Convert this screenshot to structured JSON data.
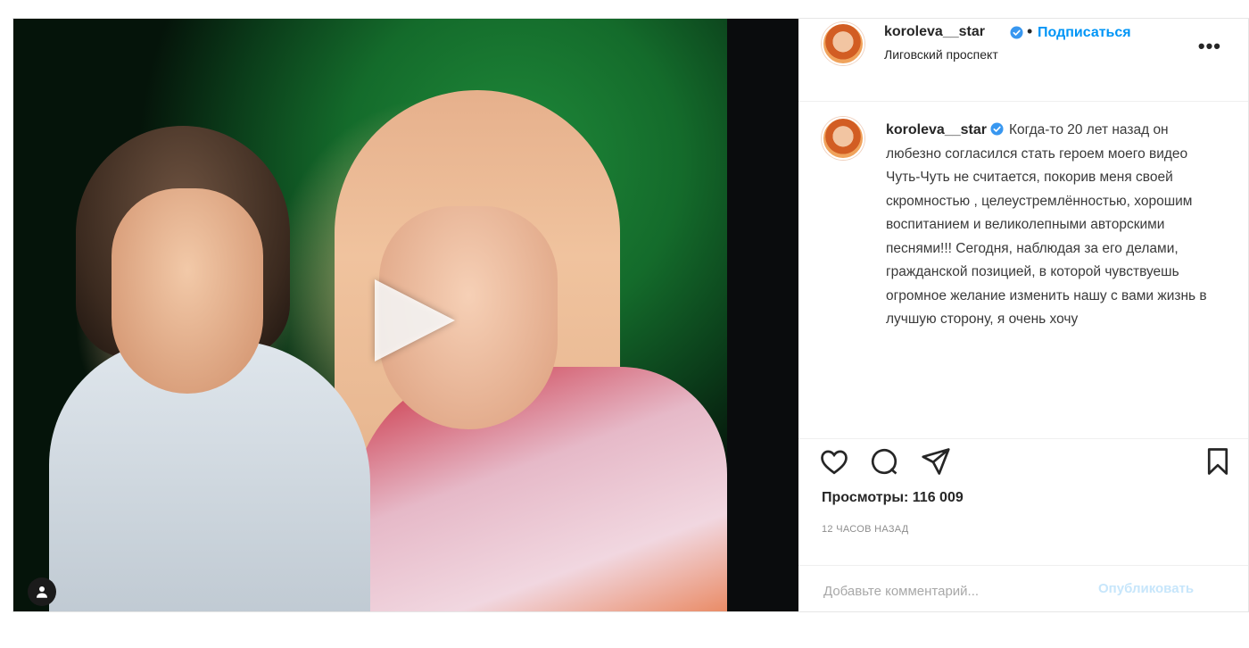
{
  "author": {
    "username": "koroleva__star",
    "follow_label": "Подписаться",
    "dot": "•",
    "location": "Лиговский проспект",
    "verified_icon": "verified-badge-icon"
  },
  "caption": {
    "username": "koroleva__star",
    "text": "Когда-то 20 лет назад он любезно согласился стать героем моего видео Чуть-Чуть не считается, покорив меня своей скромностью , целеустремлённостью, хорошим воспитанием и великолепными авторскими песнями!!! Сегодня, наблюдая за его делами, гражданской позицией, в которой чувствуешь огромное желание изменить нашу с вами жизнь в лучшую сторону, я очень хочу"
  },
  "more_label": "•••",
  "stats": {
    "views": "Просмотры: 116 009",
    "time": "12 часов назад"
  },
  "comment": {
    "placeholder": "Добавьте комментарий...",
    "publish_label": "Опубликовать"
  },
  "icons": {
    "like": "heart-icon",
    "comment": "comment-icon",
    "share": "paper-plane-icon",
    "save": "bookmark-icon",
    "play": "play-icon",
    "tag": "user-tag-icon"
  },
  "colors": {
    "accent": "#0095f6",
    "text": "#262626",
    "muted": "#8e8e8e"
  }
}
